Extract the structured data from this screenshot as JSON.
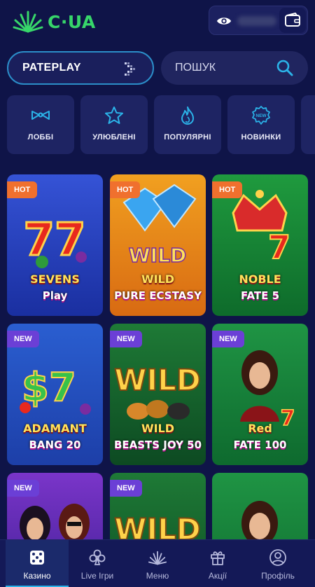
{
  "header": {
    "logo_text": "C·UA",
    "logo_icon": "palm-leaf-logo",
    "balance_icon": "eye-icon",
    "wallet_icon": "wallet-icon"
  },
  "filters": {
    "provider_label": "PATEPLAY",
    "search_label": "ПОШУК"
  },
  "categories": [
    {
      "label": "ЛОББІ",
      "icon": "bowtie-icon"
    },
    {
      "label": "УЛЮБЛЕНІ",
      "icon": "star-icon"
    },
    {
      "label": "ПОПУЛЯРНІ",
      "icon": "flame-icon"
    },
    {
      "label": "НОВИНКИ",
      "icon": "new-seal-icon"
    }
  ],
  "games": [
    {
      "badge": "HOT",
      "title_line1": "SEVENS",
      "title_line2": "Play",
      "colors": [
        "#1a2fa0",
        "#3553d6"
      ]
    },
    {
      "badge": "HOT",
      "title_line1": "WILD",
      "title_line2": "PURE ECSTASY",
      "colors": [
        "#d86a12",
        "#f1a020"
      ]
    },
    {
      "badge": "HOT",
      "title_line1": "NOBLE",
      "title_line2": "FATE 5",
      "colors": [
        "#0e6b2b",
        "#1f9a3e"
      ]
    },
    {
      "badge": "NEW",
      "title_line1": "ADAMANT",
      "title_line2": "BANG 20",
      "colors": [
        "#1d3fa8",
        "#2a5ed0"
      ]
    },
    {
      "badge": "NEW",
      "title_line1": "WILD",
      "title_line2": "BEASTS JOY 50",
      "colors": [
        "#0d4a22",
        "#1e7a36"
      ]
    },
    {
      "badge": "NEW",
      "title_line1": "Red",
      "title_line2": "FATE 100",
      "colors": [
        "#0e6a2e",
        "#1f9444"
      ]
    },
    {
      "badge": "NEW",
      "title_line1": "",
      "title_line2": "",
      "colors": [
        "#3a1d8f",
        "#7a35c9"
      ]
    },
    {
      "badge": "NEW",
      "title_line1": "WILD",
      "title_line2": "",
      "colors": [
        "#0d4a22",
        "#1e7a36"
      ]
    },
    {
      "badge": "",
      "title_line1": "",
      "title_line2": "",
      "colors": [
        "#0e6a2e",
        "#1f9444"
      ]
    }
  ],
  "bottom_nav": [
    {
      "label": "Казино",
      "icon": "dice-icon",
      "active": true
    },
    {
      "label": "Live Ігри",
      "icon": "clubs-icon",
      "active": false
    },
    {
      "label": "Меню",
      "icon": "palm-icon",
      "active": false
    },
    {
      "label": "Акції",
      "icon": "gift-icon",
      "active": false
    },
    {
      "label": "Профіль",
      "icon": "user-icon",
      "active": false
    }
  ],
  "colors": {
    "background": "#0f1448",
    "accent_green": "#37d66a",
    "accent_blue": "#2bb3e8",
    "hot_badge": "#f0702e",
    "new_badge": "#6b3fd6"
  }
}
